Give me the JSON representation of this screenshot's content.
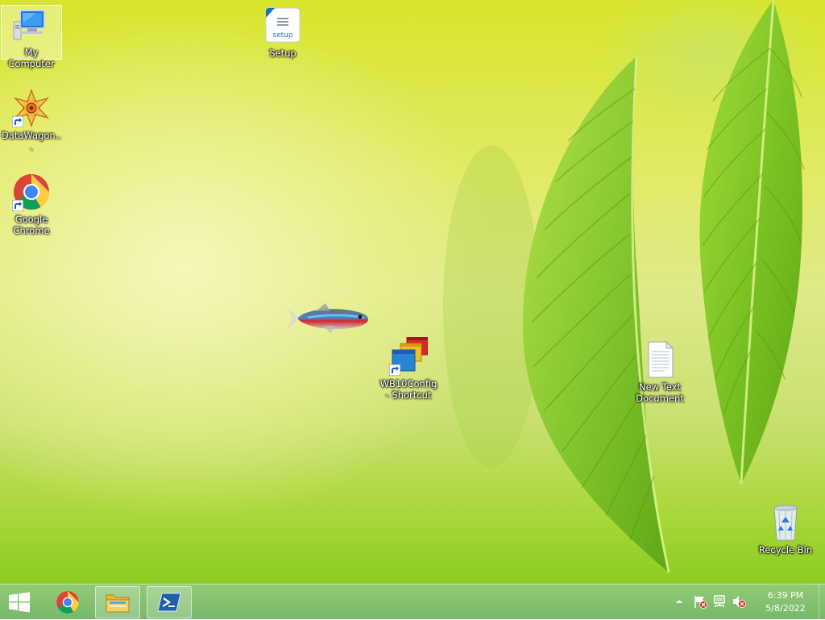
{
  "desktop": {
    "icons": {
      "my_computer": {
        "label": "My Computer",
        "icon": "computer-icon"
      },
      "setup": {
        "label": "Setup",
        "icon": "setup-icon",
        "badge_text": "setup"
      },
      "datawagon": {
        "label": "DataWagon...",
        "icon": "datawagon-icon"
      },
      "chrome": {
        "label": "Google Chrome",
        "icon": "chrome-icon"
      },
      "wb10config": {
        "label": "WB10Config - Shortcut",
        "icon": "wb10config-icon"
      },
      "new_text_document": {
        "label": "New Text Document",
        "icon": "text-document-icon"
      },
      "recycle_bin": {
        "label": "Recycle Bin",
        "icon": "recycle-bin-icon"
      }
    },
    "wallpaper": "green-leaves",
    "cursor": "fish-cursor"
  },
  "taskbar": {
    "start": {
      "icon": "windows-logo-icon"
    },
    "pinned": [
      {
        "name": "Google Chrome",
        "icon": "chrome-icon"
      },
      {
        "name": "File Explorer",
        "icon": "folder-icon"
      },
      {
        "name": "PowerShell",
        "icon": "powershell-icon"
      }
    ],
    "tray": {
      "icons": [
        "chevron-up-icon",
        "action-center-flag-icon",
        "network-icon",
        "volume-muted-icon"
      ],
      "time": "6:39 PM",
      "date": "5/8/2022"
    }
  },
  "colors": {
    "taskbar": "#7fbf6c",
    "wallpaper_top": "#d7e52a",
    "wallpaper_bottom": "#8ccc20",
    "leaf": "#7ec62a"
  }
}
